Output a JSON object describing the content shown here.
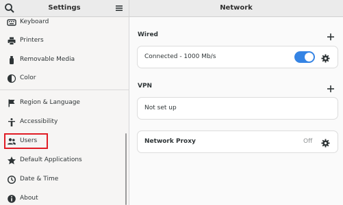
{
  "sidebar_header": {
    "title": "Settings"
  },
  "main_header": {
    "title": "Network"
  },
  "sidebar": {
    "items": [
      {
        "label": "Keyboard",
        "icon": "keyboard-icon"
      },
      {
        "label": "Printers",
        "icon": "printer-icon"
      },
      {
        "label": "Removable Media",
        "icon": "usb-drive-icon"
      },
      {
        "label": "Color",
        "icon": "color-icon"
      },
      {
        "label": "Region & Language",
        "icon": "flag-icon"
      },
      {
        "label": "Accessibility",
        "icon": "accessibility-icon"
      },
      {
        "label": "Users",
        "icon": "users-icon"
      },
      {
        "label": "Default Applications",
        "icon": "star-icon"
      },
      {
        "label": "Date & Time",
        "icon": "clock-icon"
      },
      {
        "label": "About",
        "icon": "info-icon"
      }
    ]
  },
  "wired": {
    "title": "Wired",
    "connection_label": "Connected - 1000 Mb/s",
    "enabled": true
  },
  "vpn": {
    "title": "VPN",
    "status": "Not set up"
  },
  "proxy": {
    "title": "Network Proxy",
    "status": "Off"
  },
  "colors": {
    "accent": "#3584e4",
    "highlight_box": "#e01b24"
  }
}
